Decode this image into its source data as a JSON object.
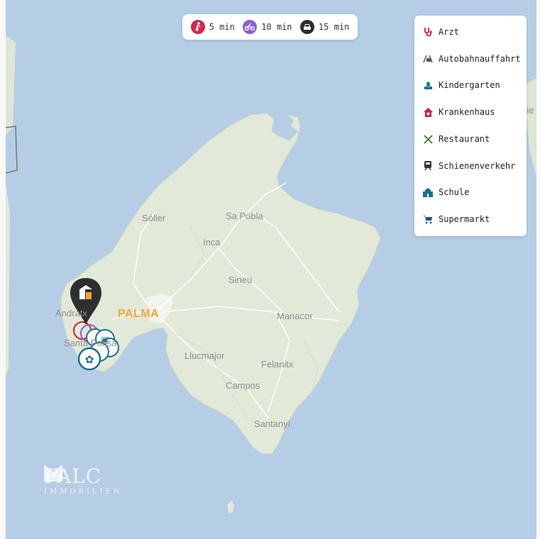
{
  "travel_times": [
    {
      "label": "5 min",
      "mode": "walk-icon",
      "color": "#d7264a"
    },
    {
      "label": "10 min",
      "mode": "bike-icon",
      "color": "#8a5fd6"
    },
    {
      "label": "15 min",
      "mode": "car-icon",
      "color": "#2c2c2c"
    }
  ],
  "legend": [
    {
      "label": "Arzt",
      "icon": "stethoscope-icon",
      "color": "#cf1f3a"
    },
    {
      "label": "Autobahnauffahrt",
      "icon": "highway-icon",
      "color": "#555555"
    },
    {
      "label": "Kindergarten",
      "icon": "kindergarten-icon",
      "color": "#1b6f8f"
    },
    {
      "label": "Krankenhaus",
      "icon": "hospital-icon",
      "color": "#cf1f3a"
    },
    {
      "label": "Restaurant",
      "icon": "restaurant-icon",
      "color": "#3d7a2e"
    },
    {
      "label": "Schienenverkehr",
      "icon": "train-icon",
      "color": "#333333"
    },
    {
      "label": "Schule",
      "icon": "school-icon",
      "color": "#1b6f8f"
    },
    {
      "label": "Supermarkt",
      "icon": "cart-icon",
      "color": "#1f4f8f"
    }
  ],
  "places": {
    "soller": "Sóller",
    "sa_pobla": "Sa Pobla",
    "inca": "Inca",
    "sineu": "Sineu",
    "andratx": "Andratx",
    "palma": "PALMA",
    "manacor": "Manacor",
    "santa_ponsa": "Santa Ponsa",
    "llucmajor": "Llucmajor",
    "felanitx": "Felanitx",
    "campos": "Campos",
    "santanyi": "Santanyí",
    "edge_label": "rie"
  },
  "logo": {
    "brand": "FALC",
    "sub": "IMMOBILIEN"
  },
  "colors": {
    "water": "#b6cde6",
    "land": "#e3e9d8",
    "accent": "#f3a53d"
  }
}
